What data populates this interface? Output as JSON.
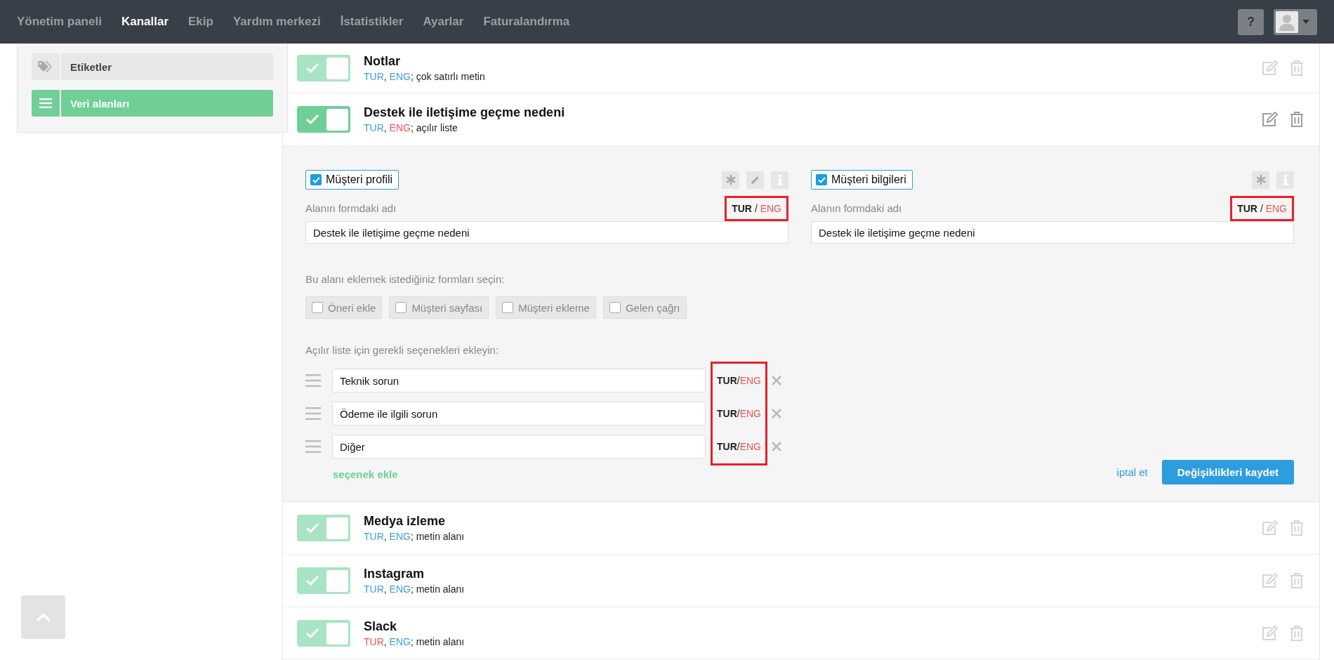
{
  "lang_separator": "/",
  "code_separator": ",",
  "type_separator": ";",
  "nav": {
    "items": [
      {
        "label": "Yönetim paneli",
        "selected": false
      },
      {
        "label": "Kanallar",
        "selected": true
      },
      {
        "label": "Ekip",
        "selected": false
      },
      {
        "label": "Yardım merkezi",
        "selected": false
      },
      {
        "label": "İstatistikler",
        "selected": false
      },
      {
        "label": "Ayarlar",
        "selected": false
      },
      {
        "label": "Faturalandırma",
        "selected": false
      }
    ],
    "help": "?"
  },
  "sidebar": {
    "items": [
      {
        "label": "Etiketler",
        "kind": "tag",
        "selected": false
      },
      {
        "label": "Veri alanları",
        "kind": "list",
        "selected": true
      }
    ]
  },
  "fields": [
    {
      "title": "Notlar",
      "on": true,
      "expanded": false,
      "languages": [
        {
          "code": "TUR",
          "color": "#3d9be0"
        },
        {
          "code": "ENG",
          "color": "#3d9be0"
        }
      ],
      "type": "çok satırlı metin"
    },
    {
      "title": "Destek ile iletişime geçme nedeni",
      "on": true,
      "expanded": true,
      "languages": [
        {
          "code": "TUR",
          "color": "#3d9be0"
        },
        {
          "code": "ENG",
          "color": "#ef5350"
        }
      ],
      "type": "açılır liste",
      "editor": {
        "columns": [
          {
            "label": "Müşteri profili",
            "checked": true,
            "icons": [
              {
                "kind": "asterisk"
              },
              {
                "kind": "pencil"
              },
              {
                "kind": "info"
              }
            ],
            "name_label": "Alanın formdaki adı",
            "lang_primary": "TUR",
            "lang_secondary": "ENG",
            "highlighted": true,
            "value": "Destek ile iletişime geçme nedeni"
          },
          {
            "label": "Müşteri bilgileri",
            "checked": true,
            "icons": [
              {
                "kind": "asterisk"
              },
              {
                "kind": "info"
              }
            ],
            "name_label": "Alanın formdaki adı",
            "lang_primary": "TUR",
            "lang_secondary": "ENG",
            "highlighted": true,
            "value": "Destek ile iletişime geçme nedeni"
          }
        ],
        "forms_label": "Bu alanı eklemek istediğiniz formları seçin:",
        "forms": [
          {
            "label": "Öneri ekle",
            "checked": false
          },
          {
            "label": "Müşteri sayfası",
            "checked": false
          },
          {
            "label": "Müşteri ekleme",
            "checked": false
          },
          {
            "label": "Gelen çağrı",
            "checked": false
          }
        ],
        "options_label": "Açılır liste için gerekli seçenekleri ekleyin:",
        "options_highlighted": true,
        "options": [
          {
            "value": "Teknik sorun",
            "lang_primary": "TUR",
            "lang_secondary": "ENG"
          },
          {
            "value": "Ödeme ile ilgili sorun",
            "lang_primary": "TUR",
            "lang_secondary": "ENG"
          },
          {
            "value": "Diğer",
            "lang_primary": "TUR",
            "lang_secondary": "ENG"
          }
        ],
        "add_option": "seçenek ekle",
        "cancel": "iptal et",
        "save": "Değişiklikleri kaydet"
      }
    },
    {
      "title": "Medya izleme",
      "on": true,
      "expanded": false,
      "languages": [
        {
          "code": "TUR",
          "color": "#3d9be0"
        },
        {
          "code": "ENG",
          "color": "#3d9be0"
        }
      ],
      "type": "metin alanı"
    },
    {
      "title": "Instagram",
      "on": true,
      "expanded": false,
      "languages": [
        {
          "code": "TUR",
          "color": "#3d9be0"
        },
        {
          "code": "ENG",
          "color": "#3d9be0"
        }
      ],
      "type": "metin alanı"
    },
    {
      "title": "Slack",
      "on": true,
      "expanded": false,
      "languages": [
        {
          "code": "TUR",
          "color": "#ef5350"
        },
        {
          "code": "ENG",
          "color": "#3d9be0"
        }
      ],
      "type": "metin alanı"
    }
  ]
}
